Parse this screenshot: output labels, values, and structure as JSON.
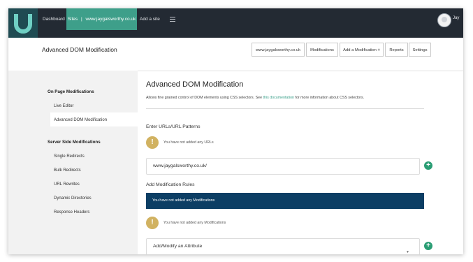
{
  "nav": {
    "dashboard": "Dashboard",
    "sites_label": "Sites",
    "site_name": "www.jaygalsworthy.co.uk",
    "add_site": "Add a site",
    "user": "Jay"
  },
  "header": {
    "title": "Advanced DOM Modification",
    "buttons": [
      "www.jaygalsworthy.co.uk",
      "Modifications",
      "Add a Modification",
      "Reports",
      "Settings"
    ]
  },
  "sidebar": {
    "on_page_heading": "On Page Modifications",
    "on_page_items": [
      "Live Editor",
      "Advanced DOM Modification"
    ],
    "server_side_heading": "Server Side Modifications",
    "server_side_items": [
      "Single Redirects",
      "Bulk Redirects",
      "URL Rewrites",
      "Dynamic Directories",
      "Response Headers"
    ]
  },
  "main": {
    "title": "Advanced DOM Modification",
    "desc_before": "Allows fine grained control of DOM elements using CSS selectors. See ",
    "desc_link": "this documentation",
    "desc_after": " for more information about CSS selectors.",
    "urls_heading": "Enter URLs/URL Patterns",
    "no_urls": "You have not added any URLs",
    "url_value": "www.jaygalsworthy.co.uk/",
    "rules_heading": "Add Modification Rules",
    "no_mods_banner": "You have not added any Modifications",
    "no_mods": "You have not added any Modifications",
    "rule_type": "Add/Modify an Attribute"
  },
  "colors": {
    "nav_bg": "#232a33",
    "accent": "#3e9f8a",
    "warning": "#d1b261",
    "banner": "#0c3e64",
    "add_button": "#2a9d74"
  },
  "icons": {
    "logo": "u-logo",
    "menu": "hamburger-icon",
    "warning": "exclamation-icon",
    "add": "plus-icon"
  }
}
